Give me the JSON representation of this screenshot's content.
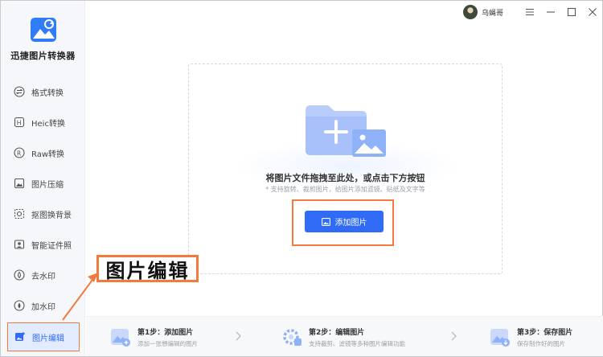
{
  "app": {
    "name": "迅捷图片转换器"
  },
  "user": {
    "name": "乌蝇哥"
  },
  "sidebar": {
    "items": [
      {
        "label": "格式转换",
        "icon": "format-convert-icon"
      },
      {
        "label": "Heic转换",
        "icon": "heic-icon"
      },
      {
        "label": "Raw转换",
        "icon": "raw-icon"
      },
      {
        "label": "图片压缩",
        "icon": "compress-icon"
      },
      {
        "label": "抠图换背景",
        "icon": "cutout-icon"
      },
      {
        "label": "智能证件照",
        "icon": "id-photo-icon"
      },
      {
        "label": "去水印",
        "icon": "remove-watermark-icon"
      },
      {
        "label": "加水印",
        "icon": "add-watermark-icon"
      },
      {
        "label": "图片编辑",
        "icon": "image-edit-icon",
        "active": true
      }
    ]
  },
  "dropzone": {
    "title": "将图片文件拖拽至此处，或点击下方按钮",
    "hint": "* 支持旋转、裁剪图片，给图片添加滤镜、贴纸及文字等",
    "button_label": "添加图片"
  },
  "annotation": {
    "text": "图片编辑"
  },
  "steps": [
    {
      "title": "第1步：添加图片",
      "desc": "添加一张想编辑的图片"
    },
    {
      "title": "第2步：编辑图片",
      "desc": "支持裁剪、滤镜等多种图片编辑功能"
    },
    {
      "title": "第3步：保存图片",
      "desc": "保存制作好的图片"
    }
  ],
  "colors": {
    "accent": "#2f6bf5",
    "highlight": "#f27a3c",
    "sidebar_bg": "#f5f7fa"
  }
}
